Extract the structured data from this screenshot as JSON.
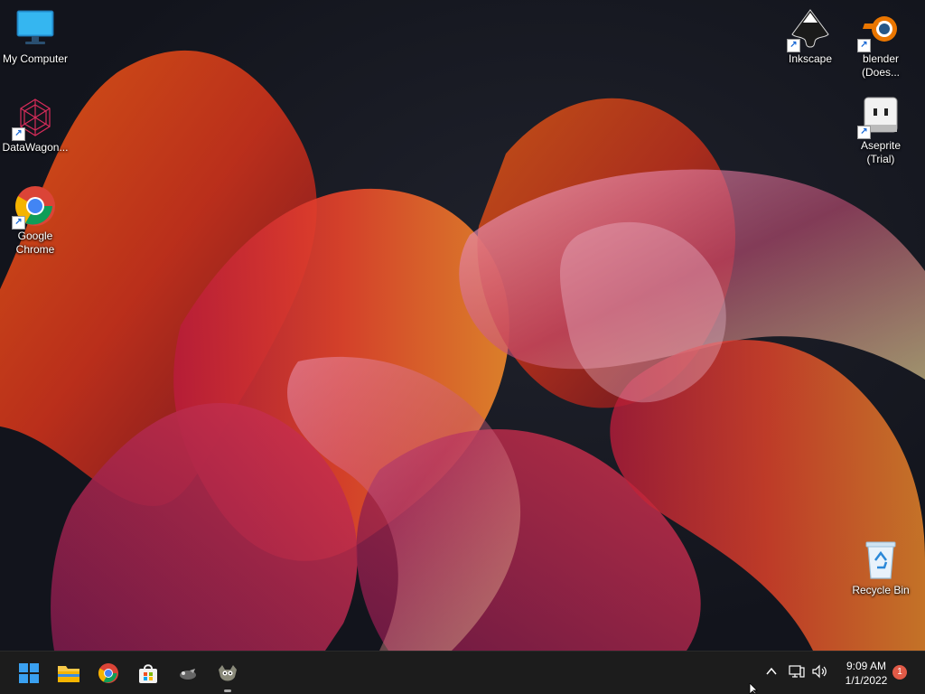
{
  "desktop": {
    "icons": [
      {
        "label": "My Computer",
        "icon": "monitor-icon"
      },
      {
        "label": "DataWagon...",
        "icon": "datawagon-icon"
      },
      {
        "label": "Google Chrome",
        "icon": "chrome-icon"
      },
      {
        "label": "Inkscape",
        "icon": "inkscape-icon"
      },
      {
        "label": "blender (Does...",
        "icon": "blender-icon"
      },
      {
        "label": "Aseprite (Trial)",
        "icon": "aseprite-icon"
      },
      {
        "label": "Recycle Bin",
        "icon": "recycle-bin-icon"
      }
    ]
  },
  "taskbar": {
    "apps": [
      "start-icon",
      "file-explorer-icon",
      "chrome-icon",
      "microsoft-store-icon",
      "inkscape-icon",
      "gimp-icon"
    ],
    "clock_time": "9:09 AM",
    "clock_date": "1/1/2022",
    "notification_count": "1"
  },
  "colors": {
    "accent": "#0078d4",
    "taskbar": "#1c1c1c",
    "badge": "#e05a47"
  }
}
